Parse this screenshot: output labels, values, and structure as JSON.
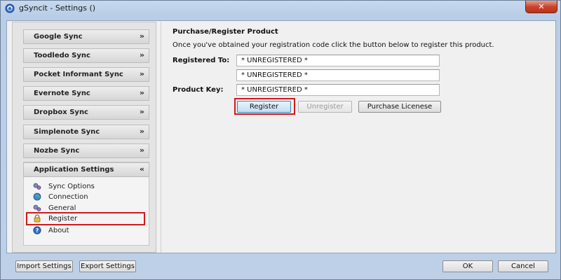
{
  "window": {
    "title": "gSyncit - Settings ()",
    "close_label": "✕"
  },
  "sidebar": {
    "sections": [
      {
        "label": "Google Sync",
        "chevron": "»"
      },
      {
        "label": "Toodledo Sync",
        "chevron": "»"
      },
      {
        "label": "Pocket Informant Sync",
        "chevron": "»"
      },
      {
        "label": "Evernote Sync",
        "chevron": "»"
      },
      {
        "label": "Dropbox Sync",
        "chevron": "»"
      },
      {
        "label": "Simplenote Sync",
        "chevron": "»"
      },
      {
        "label": "Nozbe Sync",
        "chevron": "»"
      },
      {
        "label": "Application Settings",
        "chevron": "«"
      }
    ],
    "app_items": [
      {
        "label": "Sync Options",
        "icon": "gears-icon"
      },
      {
        "label": "Connection",
        "icon": "globe-icon"
      },
      {
        "label": "General",
        "icon": "gears-icon"
      },
      {
        "label": "Register",
        "icon": "lock-icon"
      },
      {
        "label": "About",
        "icon": "help-icon"
      }
    ]
  },
  "main": {
    "section_title": "Purchase/Register Product",
    "description": "Once you've obtained your registration code click the button below to register this product.",
    "registered_to_label": "Registered To:",
    "registered_to_line1": "* UNREGISTERED *",
    "registered_to_line2": "* UNREGISTERED *",
    "product_key_label": "Product Key:",
    "product_key_value": "* UNREGISTERED *",
    "register_button": "Register",
    "unregister_button": "Unregister",
    "purchase_button": "Purchase Licenese"
  },
  "footer": {
    "import_button": "Import Settings",
    "export_button": "Export Settings",
    "ok_button": "OK",
    "cancel_button": "Cancel"
  },
  "colors": {
    "highlight": "#d0191b",
    "accent": "#3c7fb1"
  }
}
